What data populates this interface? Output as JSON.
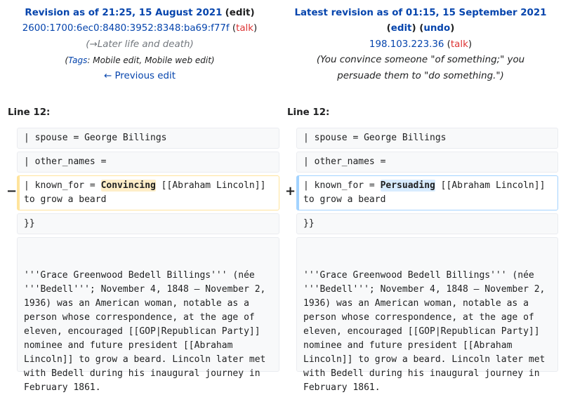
{
  "left": {
    "title": "Revision as of 21:25, 15 August 2021",
    "edit": "edit",
    "user": "2600:1700:6ec0:8480:3952:8348:ba69:f77f",
    "talk": "talk",
    "summary_arrow": "→",
    "summary": "Later life and death",
    "tags_label": "Tags",
    "tags": ": Mobile edit, Mobile web edit",
    "prev": "← Previous edit",
    "line_label": "Line 12:"
  },
  "right": {
    "title": "Latest revision as of 01:15, 15 September 2021",
    "edit": "edit",
    "undo": "undo",
    "user": "198.103.223.36",
    "talk": "talk",
    "summary": "You convince someone \"of something;\" you",
    "summary2": "persuade them to \"do something.\")",
    "line_label": "Line 12:"
  },
  "markers": {
    "minus": "−",
    "plus": "+"
  },
  "rows": {
    "spouse": "| spouse = George Billings",
    "other_names": "| other_names =",
    "known_prefix": "| known_for = ",
    "old_word": "Convincing",
    "new_word": "Persuading",
    "known_suffix": " [[Abraham Lincoln]]",
    "known_line2": "to grow a beard",
    "close": "}}",
    "para": [
      "'''Grace Greenwood Bedell Billings''' (née",
      "'''Bedell'''; November 4, 1848 – November 2,",
      "1936) was an American woman, notable as a",
      "person whose correspondence, at the age of",
      "eleven, encouraged [[GOP|Republican Party]]",
      "nominee and future president [[Abraham",
      "Lincoln]] to grow a beard. Lincoln later met",
      "with Bedell during his inaugural journey in",
      "February 1861."
    ]
  }
}
